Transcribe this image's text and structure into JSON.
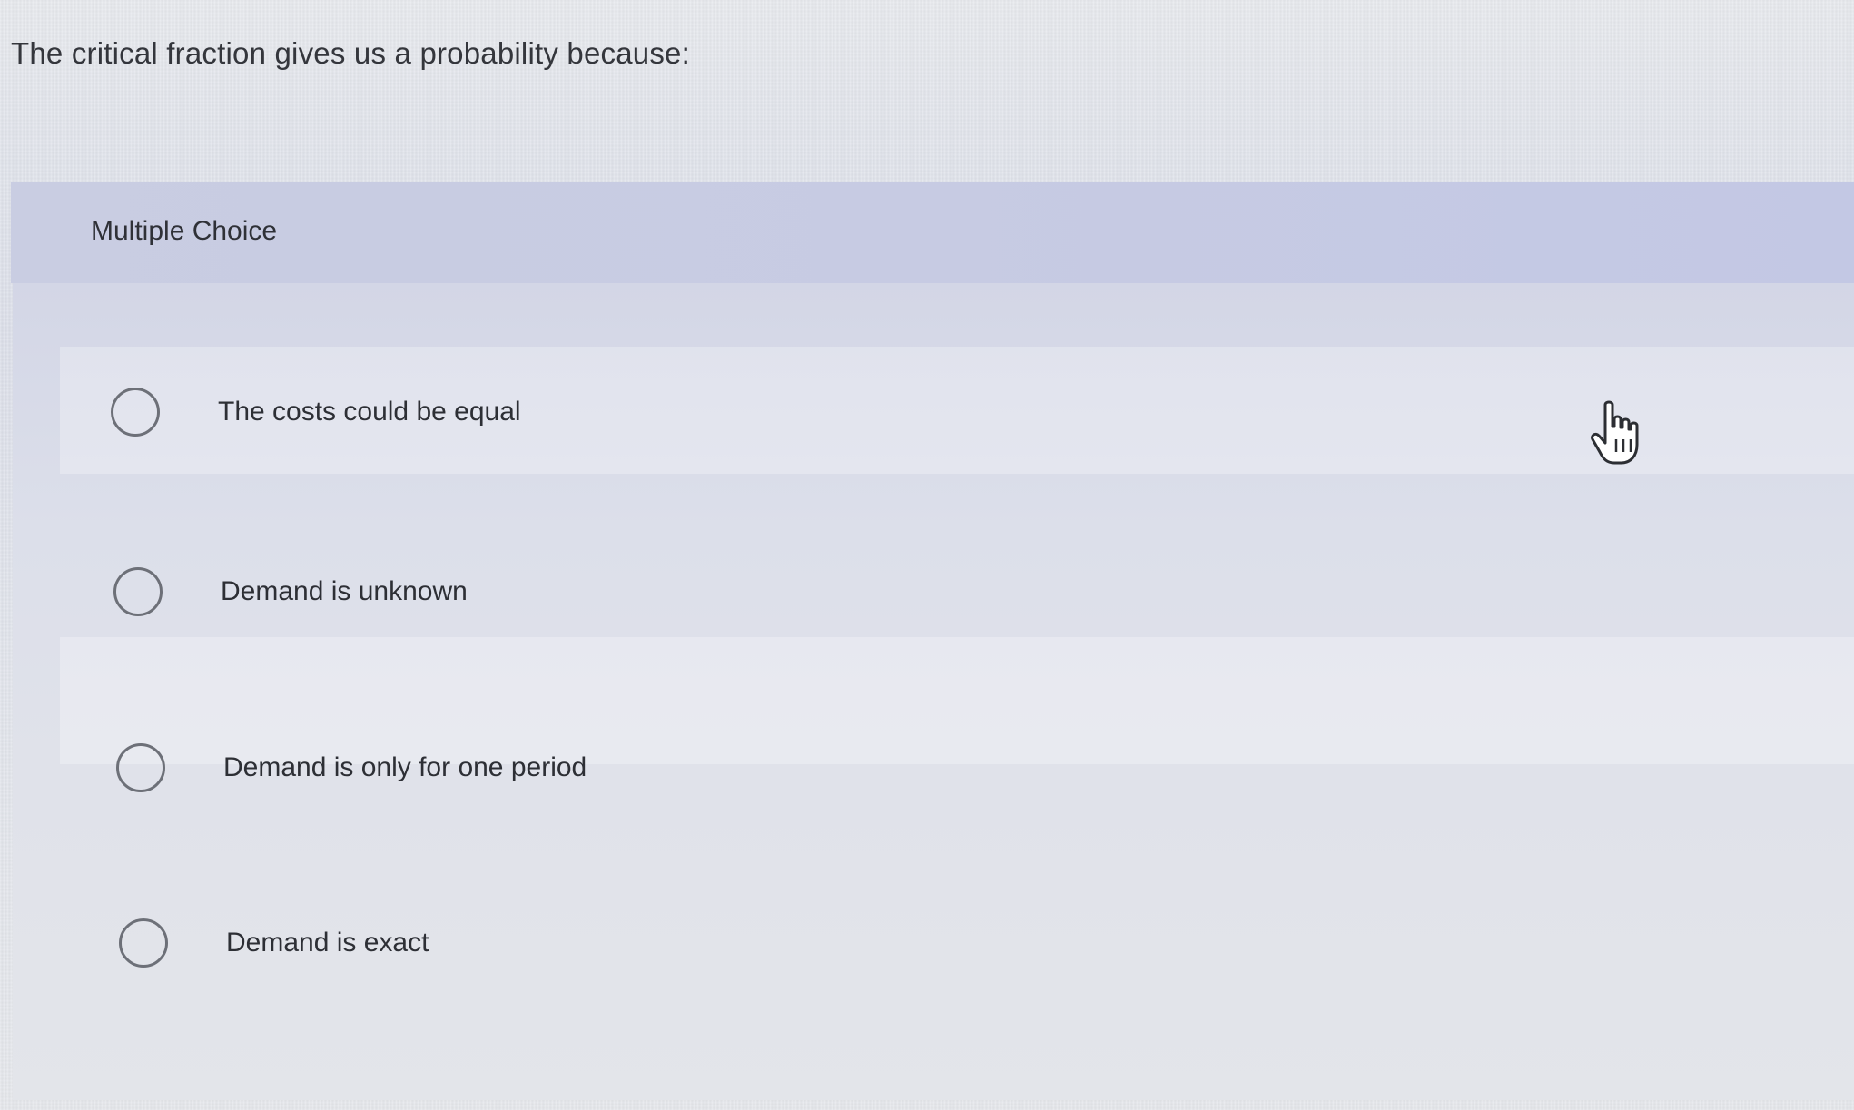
{
  "question": {
    "text": "The critical fraction gives us a probability because:"
  },
  "multiple_choice": {
    "header_label": "Multiple Choice",
    "options": [
      {
        "label": "The costs could be equal",
        "selected": false
      },
      {
        "label": "Demand is unknown",
        "selected": false
      },
      {
        "label": "Demand is only for one period",
        "selected": false
      },
      {
        "label": "Demand is exact",
        "selected": false
      }
    ]
  },
  "cursor": {
    "icon": "hand-pointer-icon"
  }
}
